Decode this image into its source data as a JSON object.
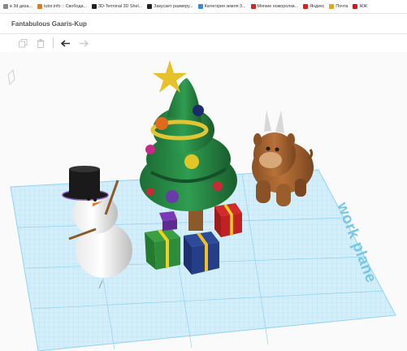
{
  "bookmarks": [
    {
      "label": "в 3d диза...",
      "color": "#888888"
    },
    {
      "label": "tutor.info :: Свобода...",
      "color": "#e07a1f"
    },
    {
      "label": "3D-Terminal 3D Shel...",
      "color": "#222222"
    },
    {
      "label": "Закусает размеру...",
      "color": "#222222"
    },
    {
      "label": "Категория земля 3...",
      "color": "#3b8ad6"
    },
    {
      "label": "Мягкие ножоролки...",
      "color": "#c92a2a"
    },
    {
      "label": "Яндекс",
      "color": "#e02020"
    },
    {
      "label": "Почта",
      "color": "#e8a21c"
    },
    {
      "label": "ЖЖ",
      "color": "#c02020"
    }
  ],
  "design": {
    "title": "Fantabulous Gaaris-Kup"
  },
  "toolbar": {
    "copy_icon": "copy-icon",
    "delete_icon": "trash-icon",
    "undo_icon": "undo-icon",
    "redo_icon": "redo-icon"
  },
  "workplane": {
    "watermark": "work plane",
    "grid_color": "#8fd3ef",
    "grid_fill": "#d6eef9"
  },
  "scene": {
    "objects": [
      "snowman",
      "christmas-tree",
      "gift-box",
      "gift-box",
      "gift-box",
      "gift-box",
      "bull-figure"
    ]
  }
}
